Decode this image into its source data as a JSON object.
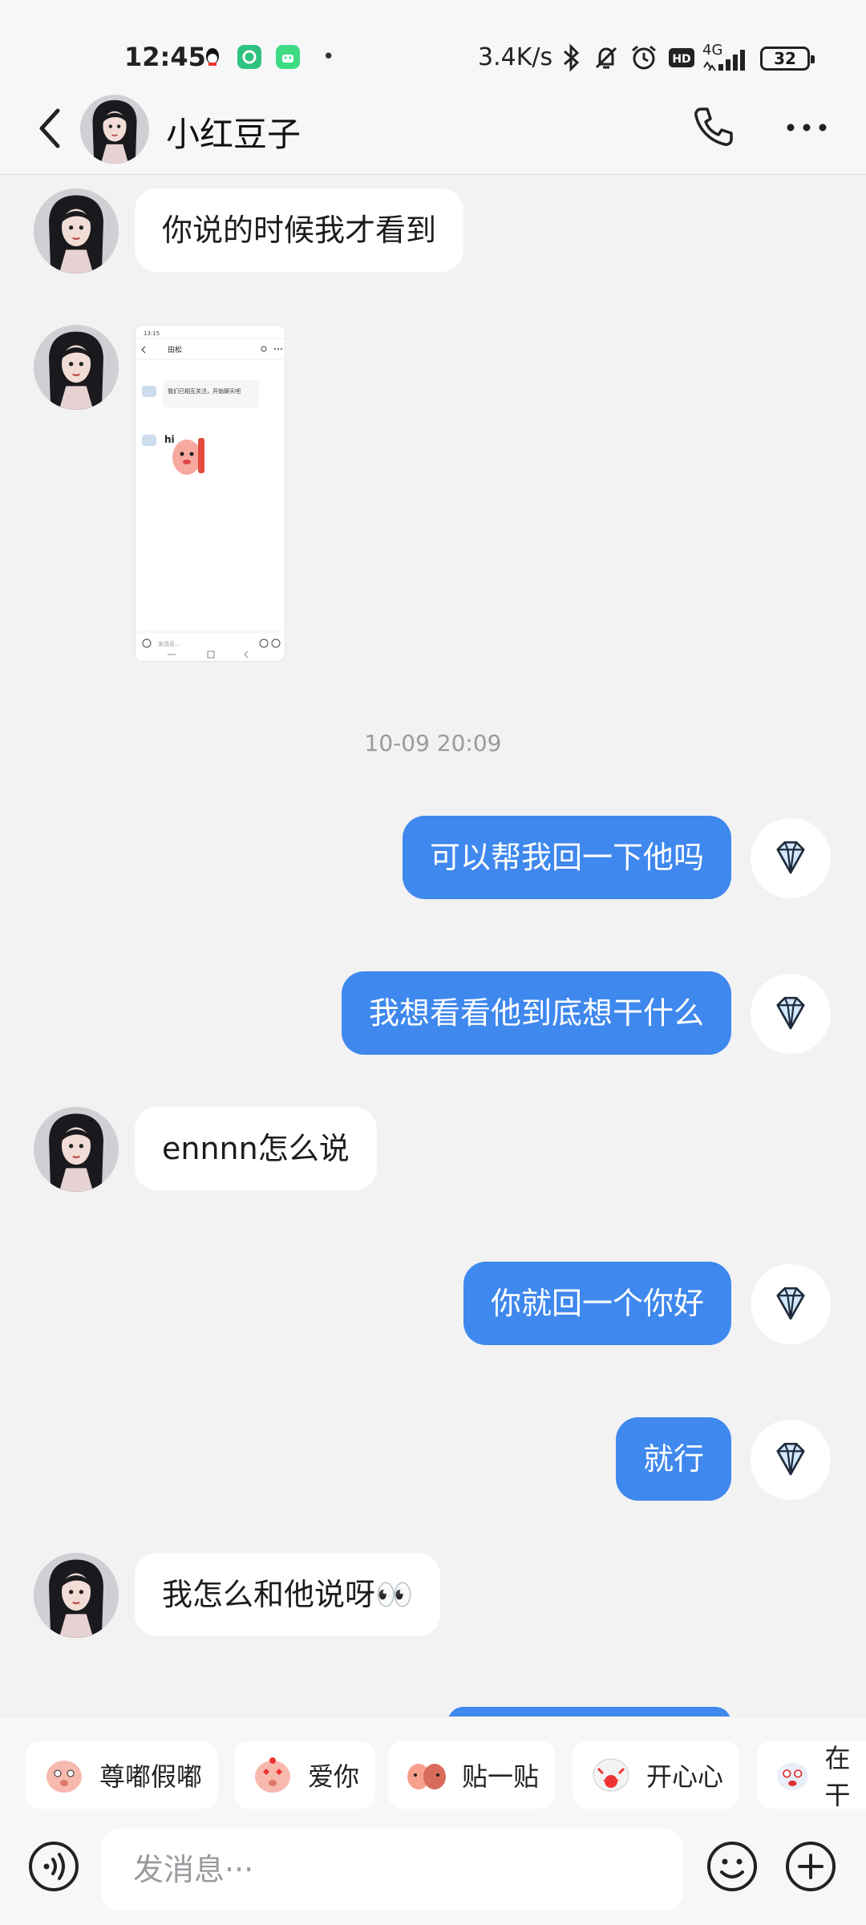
{
  "status_bar": {
    "time": "12:45",
    "net_speed": "3.4K/s",
    "battery": "32",
    "network": "4G"
  },
  "header": {
    "contact_name": "小红豆子"
  },
  "timestamp": "10-09 20:09",
  "messages": [
    {
      "side": "in",
      "text": "你说的时候我才看到"
    },
    {
      "side": "in",
      "type": "image"
    },
    {
      "side": "out",
      "text": "可以帮我回一下他吗"
    },
    {
      "side": "out",
      "text": "我想看看他到底想干什么"
    },
    {
      "side": "in",
      "text": "ennnn怎么说"
    },
    {
      "side": "out",
      "text": "你就回一个你好"
    },
    {
      "side": "out",
      "text": "就行"
    },
    {
      "side": "in",
      "text": "我怎么和他说呀👀"
    }
  ],
  "screenshot_thumb": {
    "time": "13:15",
    "title": "田松",
    "system_text": "我们已相互关注，开始聊天吧",
    "sticker_text": "hi",
    "input_placeholder": "发消息..."
  },
  "stickers": [
    {
      "label": "尊嘟假嘟"
    },
    {
      "label": "爱你"
    },
    {
      "label": "贴一贴"
    },
    {
      "label": "开心心"
    },
    {
      "label": "在干"
    }
  ],
  "input": {
    "placeholder": "发消息···"
  },
  "colors": {
    "outgoing_bubble": "#3f88ee",
    "incoming_bubble": "#ffffff",
    "background": "#f2f2f3"
  },
  "icons": {
    "self_avatar": "diamond-icon",
    "call": "phone-icon",
    "more": "more-dots-icon",
    "voice": "voice-icon",
    "emoji": "emoji-icon",
    "plus": "plus-icon"
  }
}
